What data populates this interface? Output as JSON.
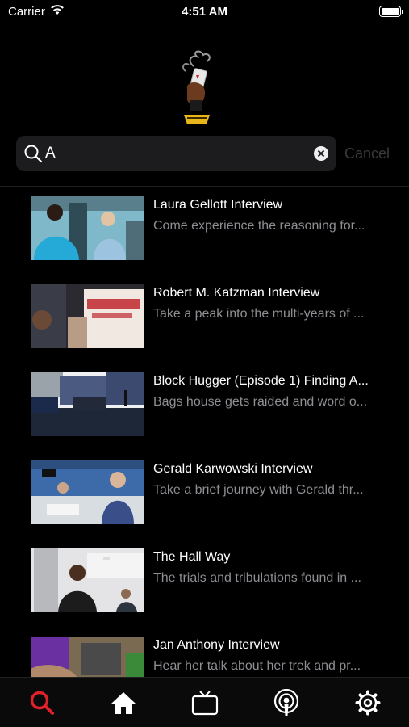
{
  "status_bar": {
    "carrier": "Carrier",
    "time": "4:51 AM"
  },
  "search": {
    "value": "A",
    "cancel_label": "Cancel"
  },
  "results": [
    {
      "title": "Laura Gellott Interview",
      "description": "Come experience the reasoning for..."
    },
    {
      "title": "Robert M. Katzman Interview",
      "description": "Take a peak into the multi-years of ..."
    },
    {
      "title": "Block Hugger (Episode 1) Finding A...",
      "description": "Bags house gets raided and word o..."
    },
    {
      "title": "Gerald Karwowski Interview",
      "description": "Take a brief journey with Gerald thr..."
    },
    {
      "title": "The Hall Way",
      "description": "The trials and tribulations found in ..."
    },
    {
      "title": "Jan Anthony Interview",
      "description": "Hear her talk about her trek and pr..."
    }
  ],
  "tabs": [
    {
      "icon": "search-icon",
      "active": true
    },
    {
      "icon": "home-icon",
      "active": false
    },
    {
      "icon": "tv-icon",
      "active": false
    },
    {
      "icon": "podcast-icon",
      "active": false
    },
    {
      "icon": "gear-icon",
      "active": false
    }
  ],
  "colors": {
    "background": "#000000",
    "accent": "#e0202a",
    "search_field": "#1c1c1e",
    "secondary_text": "#8e8e93"
  }
}
